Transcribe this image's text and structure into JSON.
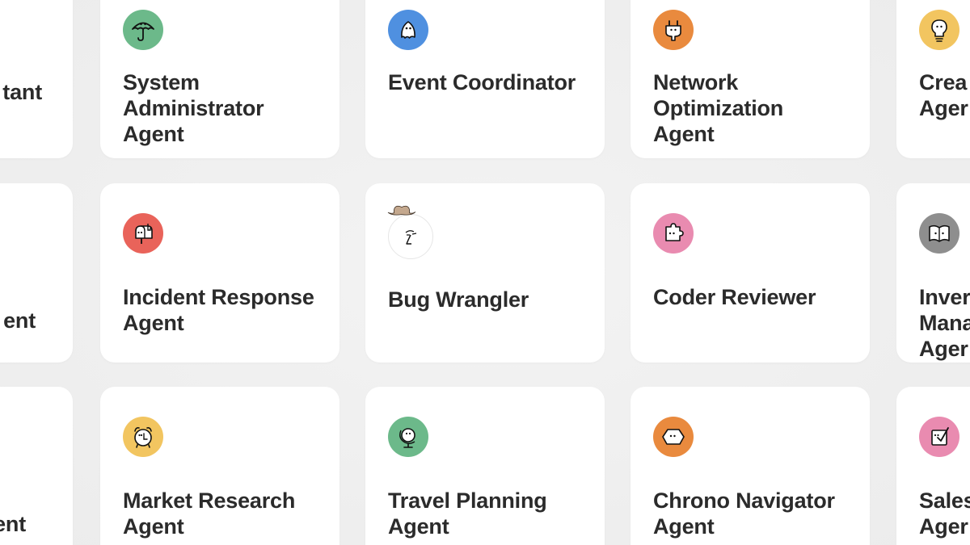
{
  "cards": {
    "r0c0": {
      "title": "tant",
      "color": "#ffffff"
    },
    "r0c1": {
      "title": "System Administrator Agent",
      "icon": "umbrella-icon",
      "color": "#6cb98a"
    },
    "r0c2": {
      "title": "Event Coordinator",
      "icon": "ghost-icon",
      "color": "#4f90e0"
    },
    "r0c3": {
      "title": "Network Optimization Agent",
      "icon": "plug-icon",
      "color": "#e98a3e"
    },
    "r0c4": {
      "title": "Crea Ager",
      "icon": "lightbulb-icon",
      "color": "#f2c560"
    },
    "r1c0": {
      "title": "ent",
      "color": "#ffffff"
    },
    "r1c1": {
      "title": "Incident Response Agent",
      "icon": "mailbox-icon",
      "color": "#e9635a"
    },
    "r1c2": {
      "title": "Bug Wrangler",
      "icon": "cowboy-face-icon",
      "color": "#ffffff"
    },
    "r1c3": {
      "title": "Coder Reviewer",
      "icon": "puzzle-icon",
      "color": "#e98bb0"
    },
    "r1c4": {
      "title": "Inver Mana Ager",
      "icon": "book-icon",
      "color": "#8e8e8e"
    },
    "r2c0": {
      "title": "ent",
      "color": "#ffffff"
    },
    "r2c1": {
      "title": "Market Research Agent",
      "icon": "alarm-clock-icon",
      "color": "#f2c560"
    },
    "r2c2": {
      "title": "Travel Planning Agent",
      "icon": "globe-icon",
      "color": "#6cb98a"
    },
    "r2c3": {
      "title": "Chrono Navigator Agent",
      "icon": "hexagon-icon",
      "color": "#e98a3e"
    },
    "r2c4": {
      "title": "Sales Ager",
      "icon": "checkbox-icon",
      "color": "#e98bb0"
    }
  }
}
